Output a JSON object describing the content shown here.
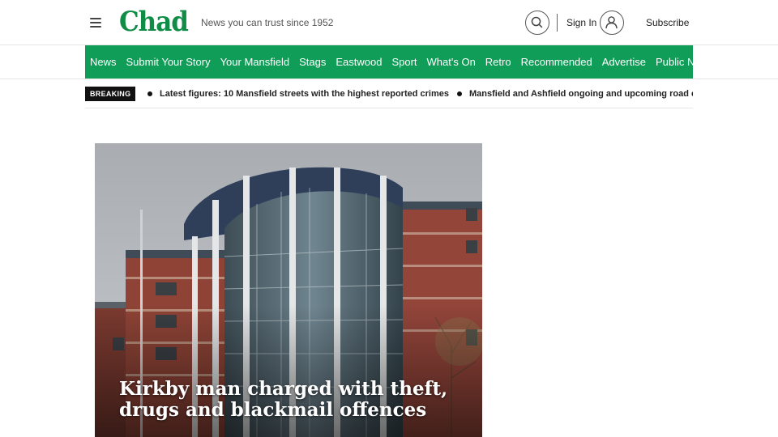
{
  "header": {
    "logo": "Chad",
    "tagline": "News you can trust since 1952",
    "sign_in_label": "Sign In",
    "subscribe_label": "Subscribe",
    "icons": {
      "menu": "hamburger-menu-icon",
      "search": "search-icon",
      "account": "user-account-icon"
    },
    "brand_color": "#0f8d47"
  },
  "nav": {
    "background": "#0f9d58",
    "items": [
      {
        "label": "News"
      },
      {
        "label": "Submit Your Story"
      },
      {
        "label": "Your Mansfield"
      },
      {
        "label": "Stags"
      },
      {
        "label": "Eastwood"
      },
      {
        "label": "Sport"
      },
      {
        "label": "What's On"
      },
      {
        "label": "Retro"
      },
      {
        "label": "Recommended"
      },
      {
        "label": "Advertise"
      },
      {
        "label": "Public Notices"
      }
    ]
  },
  "breaking": {
    "badge": "BREAKING",
    "items": [
      {
        "text": "Latest figures: 10 Mansfield streets with the highest reported crimes"
      },
      {
        "text": "Mansfield and Ashfield ongoing and upcoming road closures"
      }
    ]
  },
  "hero": {
    "headline": "Kirkby man charged with theft, drugs and blackmail offences"
  }
}
